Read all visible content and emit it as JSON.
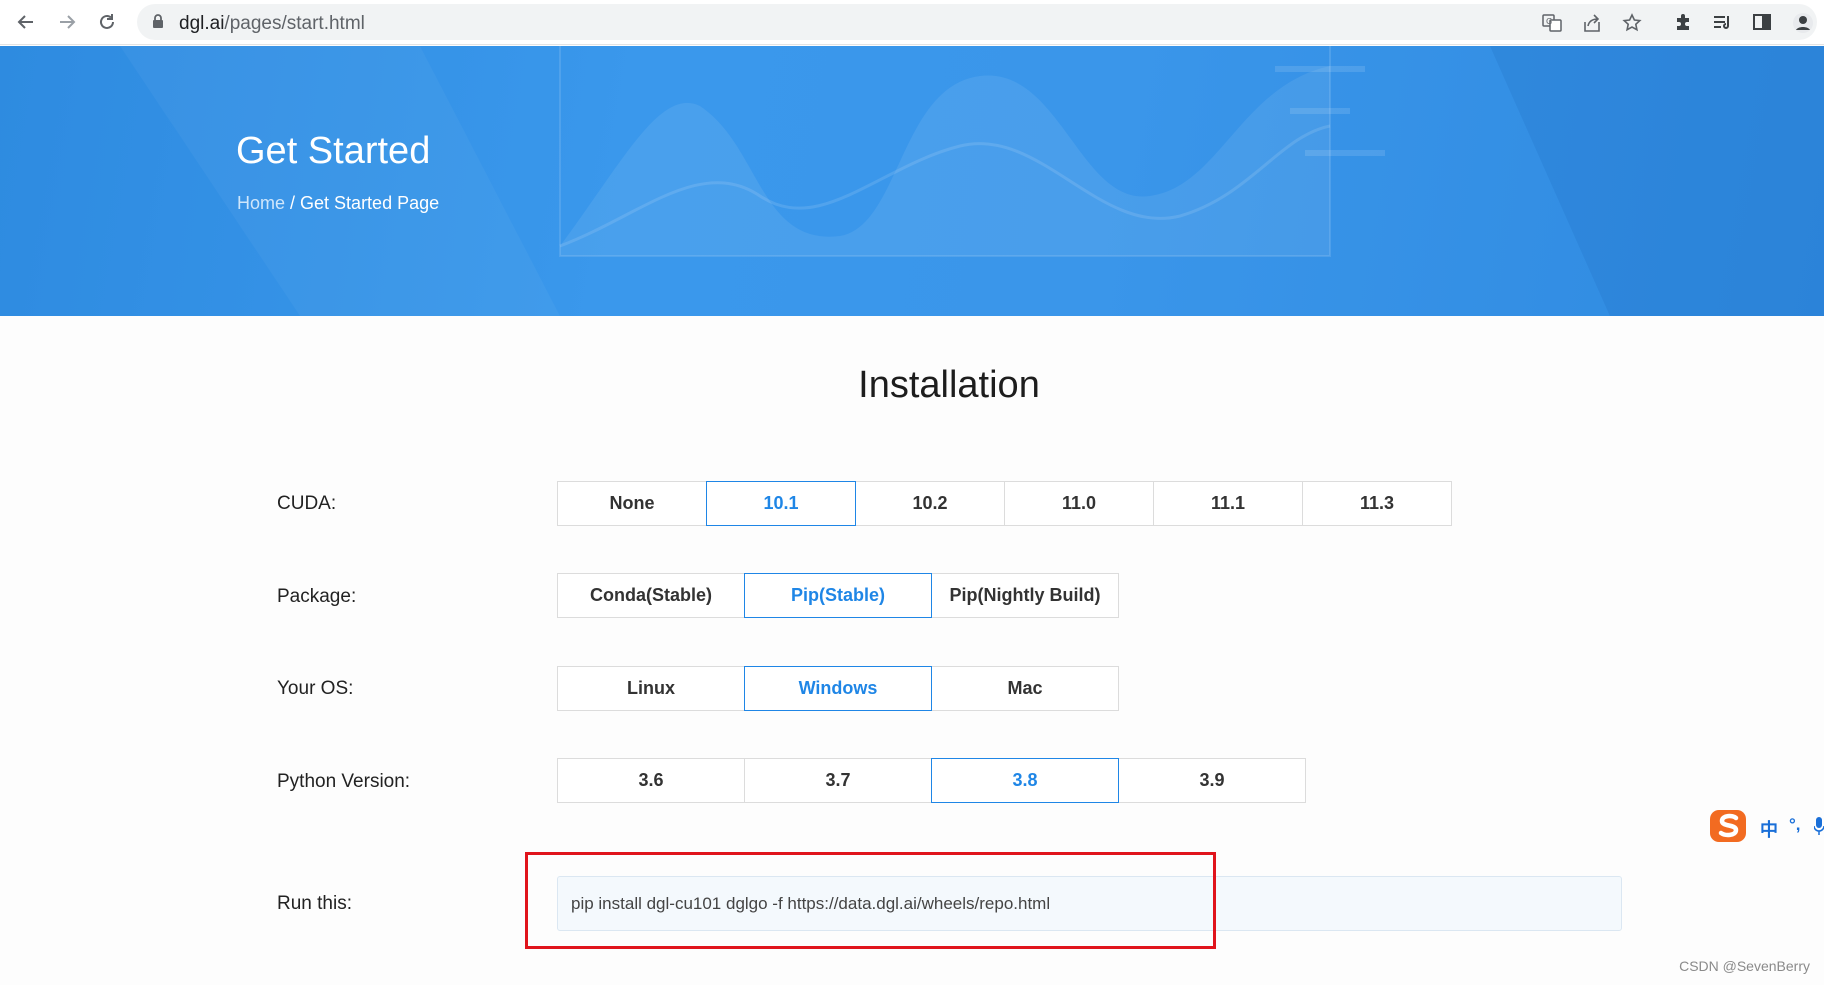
{
  "browser": {
    "url_host": "dgl.ai",
    "url_path": "/pages/start.html"
  },
  "hero": {
    "title": "Get Started",
    "breadcrumb_home": "Home",
    "breadcrumb_separator": " / ",
    "breadcrumb_current": "Get Started Page"
  },
  "installation": {
    "title": "Installation",
    "rows": {
      "cuda": {
        "label": "CUDA:",
        "options": [
          "None",
          "10.1",
          "10.2",
          "11.0",
          "11.1",
          "11.3"
        ],
        "selected": "10.1"
      },
      "package": {
        "label": "Package:",
        "options": [
          "Conda(Stable)",
          "Pip(Stable)",
          "Pip(Nightly Build)"
        ],
        "selected": "Pip(Stable)"
      },
      "os": {
        "label": "Your OS:",
        "options": [
          "Linux",
          "Windows",
          "Mac"
        ],
        "selected": "Windows"
      },
      "python": {
        "label": "Python Version:",
        "options": [
          "3.6",
          "3.7",
          "3.8",
          "3.9"
        ],
        "selected": "3.8"
      }
    },
    "run": {
      "label": "Run this:",
      "command": "pip install dgl-cu101 dglgo -f https://data.dgl.ai/wheels/repo.html"
    }
  },
  "ime": {
    "lang": "中",
    "punct": "°,"
  },
  "watermark": "CSDN @SevenBerry",
  "colors": {
    "accent": "#1f86e6",
    "hero": "#3a98ec",
    "highlight": "#e0141c"
  }
}
